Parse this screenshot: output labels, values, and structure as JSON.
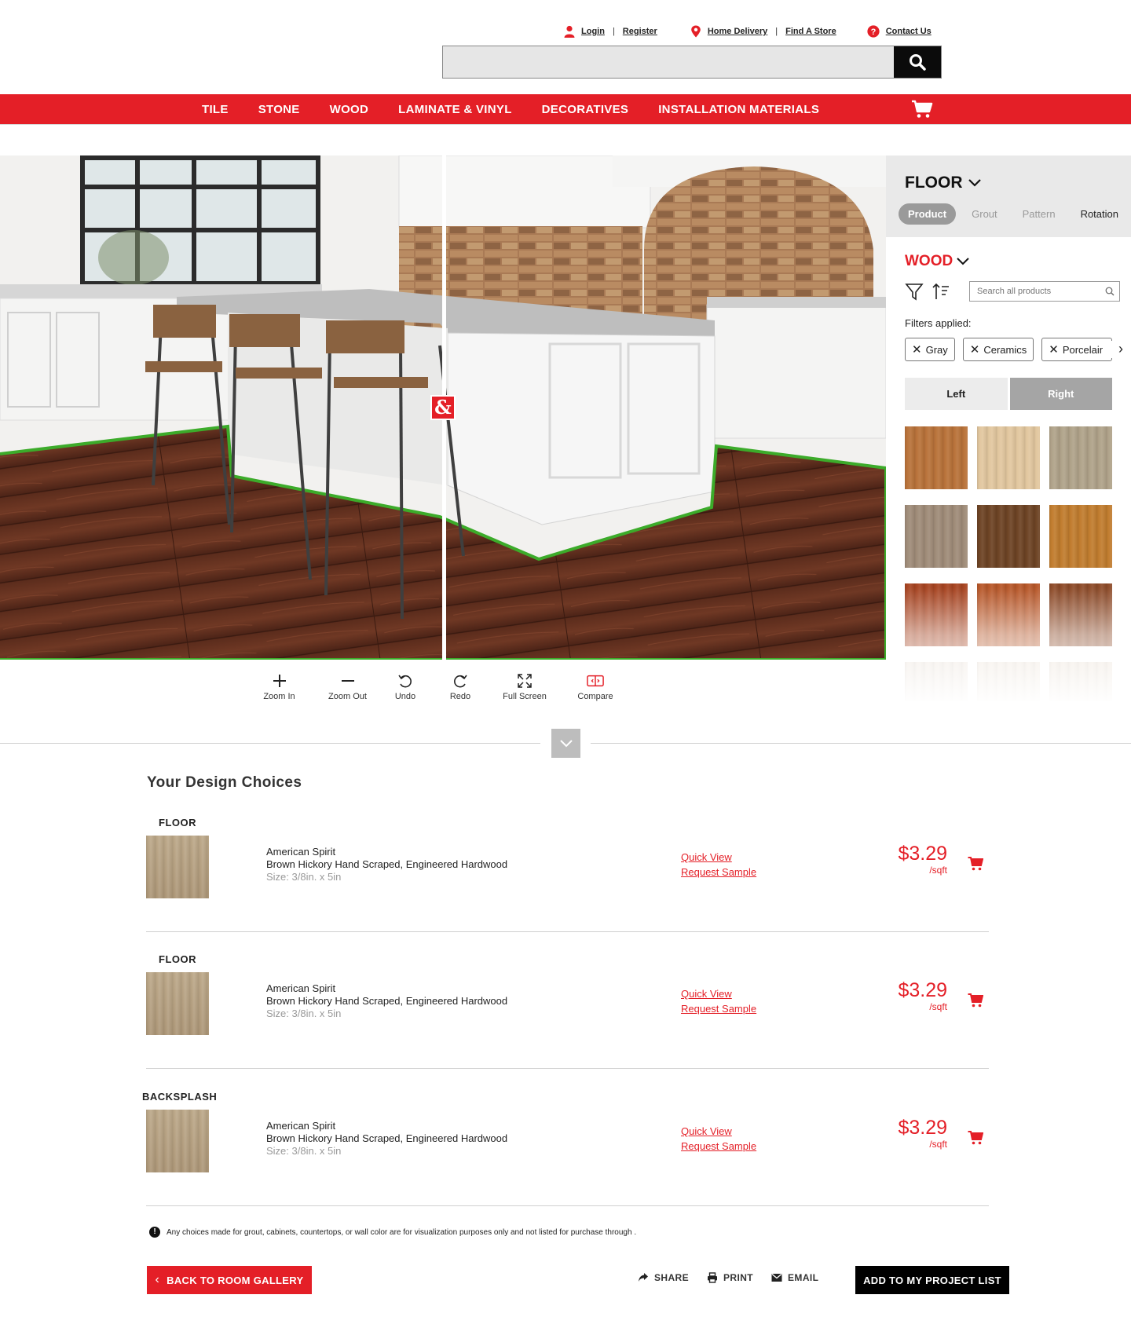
{
  "utility": {
    "login": "Login",
    "register": "Register",
    "home_delivery": "Home Delivery",
    "find_store": "Find A Store",
    "contact": "Contact Us"
  },
  "search": {
    "placeholder": "",
    "value": ""
  },
  "nav": {
    "items": [
      "TILE",
      "STONE",
      "WOOD",
      "LAMINATE & VINYL",
      "DECORATIVES",
      "INSTALLATION MATERIALS"
    ]
  },
  "visualizer": {
    "logo_glyph": "&",
    "tools": {
      "zoom_in": "Zoom In",
      "zoom_out": "Zoom Out",
      "undo": "Undo",
      "redo": "Redo",
      "full_screen": "Full Screen",
      "compare": "Compare"
    },
    "highlight_color": "#3cab2a"
  },
  "panel": {
    "surface": "FLOOR",
    "tabs": {
      "product": "Product",
      "grout": "Grout",
      "pattern": "Pattern",
      "rotation": "Rotation"
    },
    "category": "WOOD",
    "search_placeholder": "Search all products",
    "filters_label": "Filters applied:",
    "filters": [
      "Gray",
      "Ceramics",
      "Porcelain"
    ],
    "side_left": "Left",
    "side_right": "Right",
    "swatch_colors": [
      "#b9733a",
      "#e2c79f",
      "#b0a38a",
      "#a08c79",
      "#6e4425",
      "#c17d2f",
      "#a84522",
      "#b8582a",
      "#8e4c2a",
      "#e7dbcf",
      "#e9dccd",
      "#e6d8c8"
    ]
  },
  "design": {
    "title": "Your Design Choices",
    "choices": [
      {
        "section": "FLOOR",
        "brand": "American Spirit",
        "name": "Brown Hickory Hand Scraped, Engineered Hardwood",
        "size": "Size: 3/8in. x 5in",
        "quick_view": "Quick View",
        "request_sample": "Request Sample",
        "price": "$3.29",
        "unit": "/sqft"
      },
      {
        "section": "FLOOR",
        "brand": "American Spirit",
        "name": "Brown Hickory Hand Scraped, Engineered Hardwood",
        "size": "Size: 3/8in. x 5in",
        "quick_view": "Quick View",
        "request_sample": "Request Sample",
        "price": "$3.29",
        "unit": "/sqft"
      },
      {
        "section": "BACKSPLASH",
        "brand": "American Spirit",
        "name": "Brown Hickory Hand Scraped, Engineered Hardwood",
        "size": "Size: 3/8in. x 5in",
        "quick_view": "Quick View",
        "request_sample": "Request Sample",
        "price": "$3.29",
        "unit": "/sqft"
      }
    ],
    "note": "Any choices made for grout, cabinets, countertops, or wall color are for visualization purposes only and not listed for purchase through                  .",
    "back_button": "BACK TO ROOM GALLERY",
    "share": "SHARE",
    "print": "PRINT",
    "email": "EMAIL",
    "project_button": "ADD TO MY PROJECT LIST"
  },
  "colors": {
    "brand_red": "#e41f27",
    "black": "#0b0b0b"
  }
}
